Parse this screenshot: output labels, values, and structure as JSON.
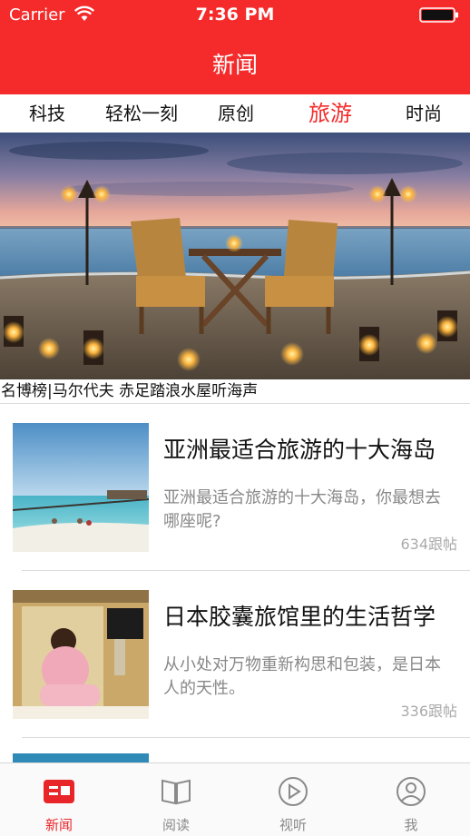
{
  "status_bar": {
    "carrier": "Carrier",
    "time": "7:36 PM"
  },
  "nav": {
    "title": "新闻"
  },
  "tabs": [
    {
      "label": "科技"
    },
    {
      "label": "轻松一刻"
    },
    {
      "label": "原创"
    },
    {
      "label": "旅游",
      "active": true
    },
    {
      "label": "时尚"
    }
  ],
  "hero": {
    "caption": "名博榜|马尔代夫 赤足踏浪水屋听海声"
  },
  "articles": [
    {
      "title": "亚洲最适合旅游的十大海岛",
      "desc": "亚洲最适合旅游的十大海岛，你最想去哪座呢?",
      "count": "634跟帖",
      "image": "beach-pier-image"
    },
    {
      "title": "日本胶囊旅馆里的生活哲学",
      "desc": "从小处对万物重新构思和包装，是日本人的天性。",
      "count": "336跟帖",
      "image": "capsule-hotel-image"
    }
  ],
  "tabbar": [
    {
      "label": "新闻",
      "icon": "news-icon",
      "active": true
    },
    {
      "label": "阅读",
      "icon": "book-icon"
    },
    {
      "label": "视听",
      "icon": "play-icon"
    },
    {
      "label": "我",
      "icon": "user-icon"
    }
  ],
  "colors": {
    "accent": "#f52b2b",
    "tab_active": "#e8262a",
    "text_muted": "#888888"
  }
}
